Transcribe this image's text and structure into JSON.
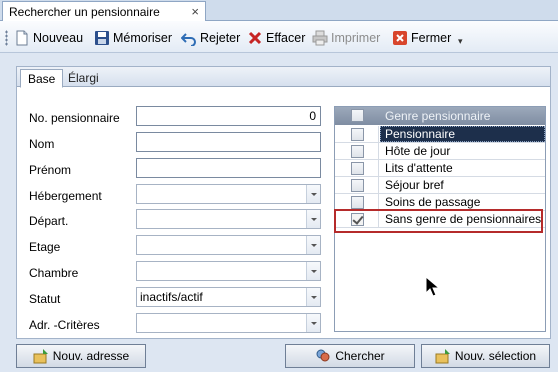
{
  "document_tab": {
    "title": "Rechercher un pensionnaire",
    "close": "×"
  },
  "toolbar": {
    "new": "Nouveau",
    "save": "Mémoriser",
    "reject": "Rejeter",
    "clear": "Effacer",
    "print": "Imprimer",
    "close": "Fermer",
    "more": "▾"
  },
  "tabs": {
    "base": "Base",
    "extended": "Élargi"
  },
  "form": {
    "no_label": "No. pensionnaire",
    "no_value": "0",
    "name_label": "Nom",
    "name_value": "",
    "firstname_label": "Prénom",
    "firstname_value": "",
    "lodging_label": "Hébergement",
    "lodging_value": "",
    "dept_label": "Départ.",
    "dept_value": "",
    "floor_label": "Etage",
    "floor_value": "",
    "room_label": "Chambre",
    "room_value": "",
    "status_label": "Statut",
    "status_value": "inactifs/actif",
    "criteria_label": "Adr. -Critères",
    "criteria_value": ""
  },
  "grid": {
    "header": "Genre pensionnaire",
    "rows": [
      {
        "label": "Pensionnaire",
        "checked": false,
        "selected": true
      },
      {
        "label": "Hôte de jour",
        "checked": false,
        "selected": false
      },
      {
        "label": "Lits d'attente",
        "checked": false,
        "selected": false
      },
      {
        "label": "Séjour bref",
        "checked": false,
        "selected": false
      },
      {
        "label": "Soins de passage",
        "checked": false,
        "selected": false
      },
      {
        "label": "Sans genre de pensionnaires",
        "checked": true,
        "selected": false
      }
    ]
  },
  "buttons": {
    "new_address": "Nouv. adresse",
    "search": "Chercher",
    "new_selection": "Nouv. sélection"
  }
}
